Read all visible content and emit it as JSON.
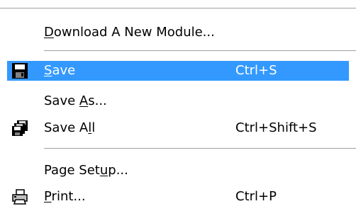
{
  "menu": {
    "items": [
      {
        "pre": "",
        "accel": "D",
        "post": "ownload A New Module...",
        "shortcut": ""
      },
      {
        "pre": "",
        "accel": "S",
        "post": "ave",
        "shortcut": "Ctrl+S",
        "icon": "floppy-disk-icon"
      },
      {
        "pre": "Save ",
        "accel": "A",
        "post": "s...",
        "shortcut": ""
      },
      {
        "pre": "Save A",
        "accel": "l",
        "post": "l",
        "shortcut": "Ctrl+Shift+S",
        "icon": "multiple-disks-icon"
      },
      {
        "pre": "Page Set",
        "accel": "u",
        "post": "p...",
        "shortcut": ""
      },
      {
        "pre": "",
        "accel": "P",
        "post": "rint...",
        "shortcut": "Ctrl+P",
        "icon": "printer-icon"
      }
    ]
  },
  "colors": {
    "highlight": "#3399ff",
    "separator": "#a0a0a0"
  }
}
